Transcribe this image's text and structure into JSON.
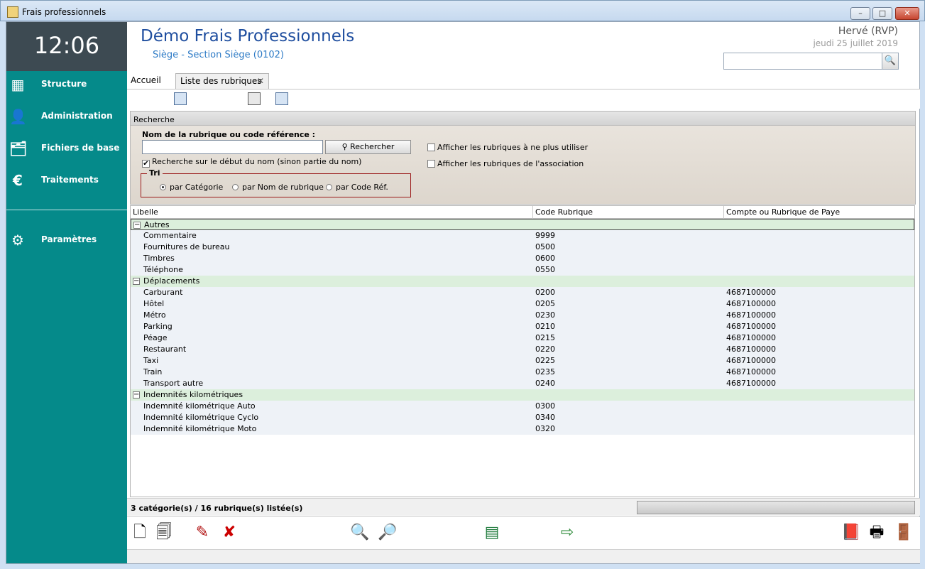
{
  "window": {
    "title": "Frais professionnels",
    "min": "–",
    "max": "□",
    "close": "✕"
  },
  "clock": "12:06",
  "nav": [
    {
      "label": "Structure",
      "icon": "building-icon",
      "glyph": "▦"
    },
    {
      "label": "Administration",
      "icon": "user-gear-icon",
      "glyph": "👤"
    },
    {
      "label": "Fichiers de base",
      "icon": "folder-user-icon",
      "glyph": "🗂"
    },
    {
      "label": "Traitements",
      "icon": "euro-document-icon",
      "glyph": "€"
    },
    {
      "label": "Paramètres",
      "icon": "gear-icon",
      "glyph": "⚙"
    }
  ],
  "header": {
    "title": "Démo Frais Professionnels",
    "subtitle": "Siège - Section Siège (0102)",
    "user": "Hervé (RVP)",
    "date": "jeudi 25 juillet 2019",
    "search_glyph": "🔍"
  },
  "tabs": {
    "home": "Accueil",
    "active": "Liste des rubriques",
    "close": "✕"
  },
  "search": {
    "panel_title": "Recherche",
    "name_label": "Nom de la rubrique ou code référence :",
    "name_value": "",
    "button_label": "Rechercher",
    "begin_check_label": "Recherche sur le début du nom (sinon partie du nom)",
    "check_mark": "✔",
    "option_unused": "Afficher les rubriques à ne plus utiliser",
    "option_association": "Afficher les rubriques de l'association",
    "tri_label": "Tri",
    "sort_category": "par Catégorie",
    "sort_name": "par Nom de rubrique",
    "sort_code": "par Code Réf."
  },
  "grid": {
    "columns": [
      "Libelle",
      "Code Rubrique",
      "Compte ou Rubrique de Paye"
    ],
    "toggle": "−",
    "groups": [
      {
        "name": "Autres",
        "rows": [
          {
            "libelle": "Commentaire",
            "code": "9999",
            "compte": ""
          },
          {
            "libelle": "Fournitures de bureau",
            "code": "0500",
            "compte": ""
          },
          {
            "libelle": "Timbres",
            "code": "0600",
            "compte": ""
          },
          {
            "libelle": "Téléphone",
            "code": "0550",
            "compte": ""
          }
        ]
      },
      {
        "name": "Déplacements",
        "rows": [
          {
            "libelle": "Carburant",
            "code": "0200",
            "compte": "4687100000"
          },
          {
            "libelle": "Hôtel",
            "code": "0205",
            "compte": "4687100000"
          },
          {
            "libelle": "Métro",
            "code": "0230",
            "compte": "4687100000"
          },
          {
            "libelle": "Parking",
            "code": "0210",
            "compte": "4687100000"
          },
          {
            "libelle": "Péage",
            "code": "0215",
            "compte": "4687100000"
          },
          {
            "libelle": "Restaurant",
            "code": "0220",
            "compte": "4687100000"
          },
          {
            "libelle": "Taxi",
            "code": "0225",
            "compte": "4687100000"
          },
          {
            "libelle": "Train",
            "code": "0235",
            "compte": "4687100000"
          },
          {
            "libelle": "Transport autre",
            "code": "0240",
            "compte": "4687100000"
          }
        ]
      },
      {
        "name": "Indemnités kilométriques",
        "rows": [
          {
            "libelle": "Indemnité kilométrique Auto",
            "code": "0300",
            "compte": ""
          },
          {
            "libelle": "Indemnité kilométrique Cyclo",
            "code": "0340",
            "compte": ""
          },
          {
            "libelle": "Indemnité kilométrique Moto",
            "code": "0320",
            "compte": ""
          }
        ]
      }
    ]
  },
  "status": {
    "text": "3 catégorie(s) / 16 rubrique(s) listée(s)"
  },
  "bottom_icons": [
    {
      "name": "new-document-icon",
      "glyph": "🗋"
    },
    {
      "name": "duplicate-document-icon",
      "glyph": "🗐"
    },
    {
      "name": "edit-document-icon",
      "glyph": "✎"
    },
    {
      "name": "delete-document-icon",
      "glyph": "✘"
    },
    {
      "name": "zoom-in-icon",
      "glyph": "🔍"
    },
    {
      "name": "zoom-out-icon",
      "glyph": "🔎"
    },
    {
      "name": "excel-export-icon",
      "glyph": "▤"
    },
    {
      "name": "export-copy-icon",
      "glyph": "⇨"
    },
    {
      "name": "book-icon",
      "glyph": "📕"
    },
    {
      "name": "printer-icon",
      "glyph": "🖶"
    },
    {
      "name": "exit-door-icon",
      "glyph": "🚪"
    }
  ],
  "top_icons": [
    {
      "name": "monitor-icon"
    },
    {
      "name": "calculator-icon"
    },
    {
      "name": "windows-icon"
    }
  ]
}
